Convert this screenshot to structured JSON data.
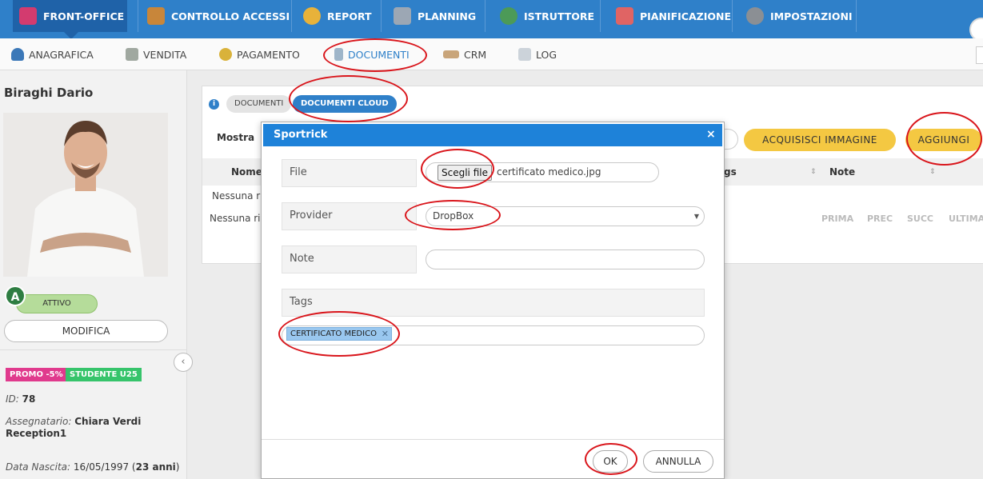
{
  "topnav": [
    {
      "label": "FRONT-OFFICE",
      "icon": "person-icon",
      "color": "#d33b6f"
    },
    {
      "label": "CONTROLLO ACCESSI",
      "icon": "turnstile-icon",
      "color": "#c8863a"
    },
    {
      "label": "REPORT",
      "icon": "pie-chart-icon",
      "color": "#e8b23a"
    },
    {
      "label": "PLANNING",
      "icon": "calendar-grid-icon",
      "color": "#9ca7b4"
    },
    {
      "label": "ISTRUTTORE",
      "icon": "trainer-icon",
      "color": "#4c9a57"
    },
    {
      "label": "PIANIFICAZIONE",
      "icon": "calendar-icon",
      "color": "#e06464"
    },
    {
      "label": "IMPOSTAZIONI",
      "icon": "gear-icon",
      "color": "#8b8f94"
    }
  ],
  "subnav": [
    {
      "label": "ANAGRAFICA",
      "icon": "user-icon"
    },
    {
      "label": "VENDITA",
      "icon": "cash-icon"
    },
    {
      "label": "PAGAMENTO",
      "icon": "coin-icon"
    },
    {
      "label": "DOCUMENTI",
      "icon": "document-icon"
    },
    {
      "label": "CRM",
      "icon": "handshake-icon"
    },
    {
      "label": "LOG",
      "icon": "log-icon"
    }
  ],
  "customer": {
    "name": "Biraghi Dario",
    "status_letter": "A",
    "status": "ATTIVO",
    "edit_label": "MODIFICA",
    "tags": [
      {
        "label": "PROMO -5%",
        "color": "#e03a8d"
      },
      {
        "label": "STUDENTE U25",
        "color": "#36c46b"
      }
    ],
    "id_label": "ID:",
    "id_value": "78",
    "assignee_label": "Assegnatario:",
    "assignee_value": "Chiara Verdi",
    "assignee_line2": "Reception1",
    "birth_label": "Data Nascita:",
    "birth_value": "16/05/1997 (",
    "age": "23 anni",
    "birth_close": ")"
  },
  "documents": {
    "tabs": [
      "DOCUMENTI",
      "DOCUMENTI CLOUD"
    ],
    "show_label": "Mostra",
    "columns": [
      "Nome",
      "gs",
      "Note"
    ],
    "empty_text_1": "Nessuna ri",
    "empty_text_2": "Nessuna rig",
    "pager": [
      "PRIMA",
      "PREC",
      "SUCC",
      "ULTIMA"
    ],
    "capture_button": "ACQUISISCI IMMAGINE",
    "add_button": "AGGIUNGI"
  },
  "modal": {
    "title": "Sportrick",
    "close_glyph": "×",
    "file_label": "File",
    "file_button": "Scegli file",
    "file_name": "certificato medico.jpg",
    "provider_label": "Provider",
    "provider_value": "DropBox",
    "note_label": "Note",
    "note_value": "",
    "tags_label": "Tags",
    "tags": [
      "CERTIFICATO MEDICO"
    ],
    "ok_button": "OK",
    "cancel_button": "ANNULLA"
  },
  "colors": {
    "topbar": "#2f80c9",
    "modal_header": "#1e82d9",
    "yellow_button": "#f4c842",
    "annotation": "#d9151b"
  }
}
